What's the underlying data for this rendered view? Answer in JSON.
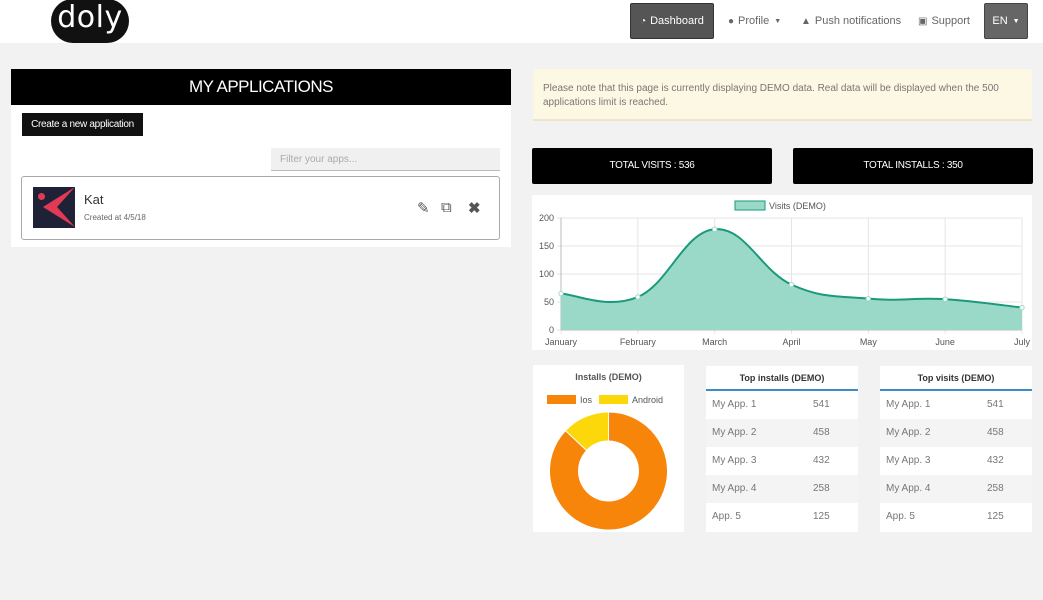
{
  "nav": {
    "logo": "doly",
    "dashboard": "Dashboard",
    "profile": "Profile",
    "push": "Push notifications",
    "support": "Support",
    "lang": "EN"
  },
  "apps": {
    "title": "MY APPLICATIONS",
    "create_label": "Create a new application",
    "filter_placeholder": "Filter your apps...",
    "items": [
      {
        "name": "Kat",
        "created": "Created at 4/5/18"
      }
    ]
  },
  "notice": "Please note that this page is currently displaying DEMO data. Real data will be displayed when the 500 applications limit is reached.",
  "totals": {
    "visits": "TOTAL VISITS : 536",
    "installs": "TOTAL INSTALLS : 350"
  },
  "colors": {
    "line": "#1a9a7a",
    "area": "#9ad9c8",
    "ios": "#f7850a",
    "android": "#fcd80a",
    "accent": "#3c8dc6"
  },
  "chart_data": [
    {
      "type": "line",
      "series": [
        {
          "name": "Visits (DEMO)",
          "values": [
            65,
            59,
            180,
            81,
            56,
            55,
            40
          ]
        }
      ],
      "categories": [
        "January",
        "February",
        "March",
        "April",
        "May",
        "June",
        "July"
      ],
      "ylim": [
        0,
        200
      ],
      "yticks": [
        0,
        50,
        100,
        150,
        200
      ],
      "grid": true,
      "legend": "top"
    },
    {
      "type": "pie",
      "title": "Installs (DEMO)",
      "labels": [
        "Ios",
        "Android"
      ],
      "values": [
        87,
        13
      ],
      "legend": "top"
    }
  ],
  "top_installs": {
    "title": "Top installs (DEMO)",
    "rows": [
      {
        "name": "My App. 1",
        "value": "541"
      },
      {
        "name": "My App. 2",
        "value": "458"
      },
      {
        "name": "My App. 3",
        "value": "432"
      },
      {
        "name": "My App. 4",
        "value": "258"
      },
      {
        "name": "App. 5",
        "value": "125"
      }
    ]
  },
  "top_visits": {
    "title": "Top visits (DEMO)",
    "rows": [
      {
        "name": "My App. 1",
        "value": "541"
      },
      {
        "name": "My App. 2",
        "value": "458"
      },
      {
        "name": "My App. 3",
        "value": "432"
      },
      {
        "name": "My App. 4",
        "value": "258"
      },
      {
        "name": "App. 5",
        "value": "125"
      }
    ]
  }
}
